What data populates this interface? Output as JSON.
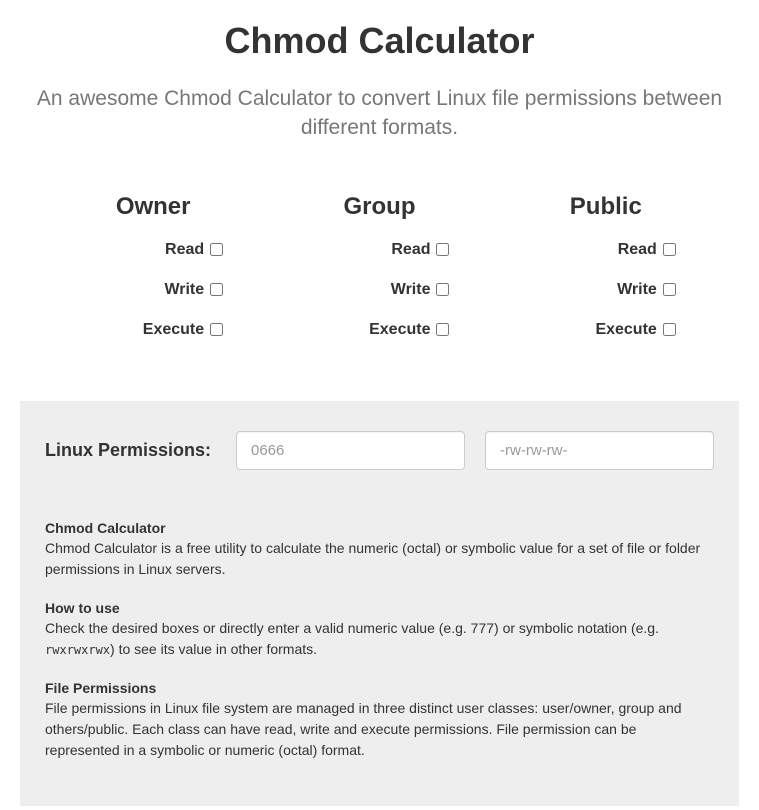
{
  "title": "Chmod Calculator",
  "subtitle": "An awesome Chmod Calculator to convert Linux file permissions between different formats.",
  "columns": [
    {
      "heading": "Owner",
      "read": "Read",
      "write": "Write",
      "execute": "Execute"
    },
    {
      "heading": "Group",
      "read": "Read",
      "write": "Write",
      "execute": "Execute"
    },
    {
      "heading": "Public",
      "read": "Read",
      "write": "Write",
      "execute": "Execute"
    }
  ],
  "results": {
    "label": "Linux Permissions:",
    "octal_placeholder": "0666",
    "symbolic_placeholder": "-rw-rw-rw-",
    "octal_value": "",
    "symbolic_value": ""
  },
  "info": [
    {
      "heading": "Chmod Calculator",
      "body": "Chmod Calculator is a free utility to calculate the numeric (octal) or symbolic value for a set of file or folder permissions in Linux servers."
    },
    {
      "heading": "How to use",
      "body_prefix": "Check the desired boxes or directly enter a valid numeric value (e.g. 777) or symbolic notation (e.g. ",
      "body_code": "rwxrwxrwx",
      "body_suffix": ") to see its value in other formats."
    },
    {
      "heading": "File Permissions",
      "body": "File permissions in Linux file system are managed in three distinct user classes: user/owner, group and others/public. Each class can have read, write and execute permissions. File permission can be represented in a symbolic or numeric (octal) format."
    }
  ]
}
